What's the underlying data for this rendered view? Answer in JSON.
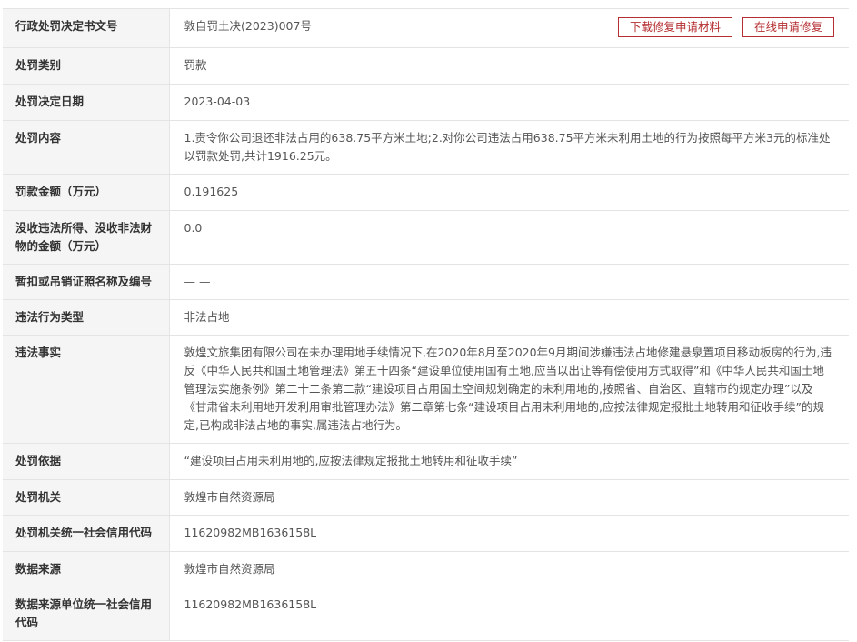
{
  "actions": {
    "download_label": "下载修复申请材料",
    "apply_label": "在线申请修复"
  },
  "rows": [
    {
      "label": "行政处罚决定书文号",
      "value": "敦自罚土决(2023)007号"
    },
    {
      "label": "处罚类别",
      "value": "罚款"
    },
    {
      "label": "处罚决定日期",
      "value": "2023-04-03"
    },
    {
      "label": "处罚内容",
      "value": "1.责令你公司退还非法占用的638.75平方米土地;2.对你公司违法占用638.75平方米未利用土地的行为按照每平方米3元的标准处以罚款处罚,共计1916.25元。"
    },
    {
      "label": "罚款金额（万元）",
      "value": "0.191625"
    },
    {
      "label": "没收违法所得、没收非法财物的金额（万元）",
      "value": "0.0"
    },
    {
      "label": "暂扣或吊销证照名称及编号",
      "value": "— —"
    },
    {
      "label": "违法行为类型",
      "value": "非法占地"
    },
    {
      "label": "违法事实",
      "value": "敦煌文旅集团有限公司在未办理用地手续情况下,在2020年8月至2020年9月期间涉嫌违法占地修建悬泉置项目移动板房的行为,违反《中华人民共和国土地管理法》第五十四条“建设单位使用国有土地,应当以出让等有偿使用方式取得”和《中华人民共和国土地管理法实施条例》第二十二条第二款“建设项目占用国土空间规划确定的未利用地的,按照省、自治区、直辖市的规定办理”以及《甘肃省未利用地开发利用审批管理办法》第二章第七条“建设项目占用未利用地的,应按法律规定报批土地转用和征收手续”的规定,已构成非法占地的事实,属违法占地行为。"
    },
    {
      "label": "处罚依据",
      "value": "“建设项目占用未利用地的,应按法律规定报批土地转用和征收手续”"
    },
    {
      "label": "处罚机关",
      "value": "敦煌市自然资源局"
    },
    {
      "label": "处罚机关统一社会信用代码",
      "value": "11620982MB1636158L"
    },
    {
      "label": "数据来源",
      "value": "敦煌市自然资源局"
    },
    {
      "label": "数据来源单位统一社会信用代码",
      "value": "11620982MB1636158L"
    }
  ]
}
